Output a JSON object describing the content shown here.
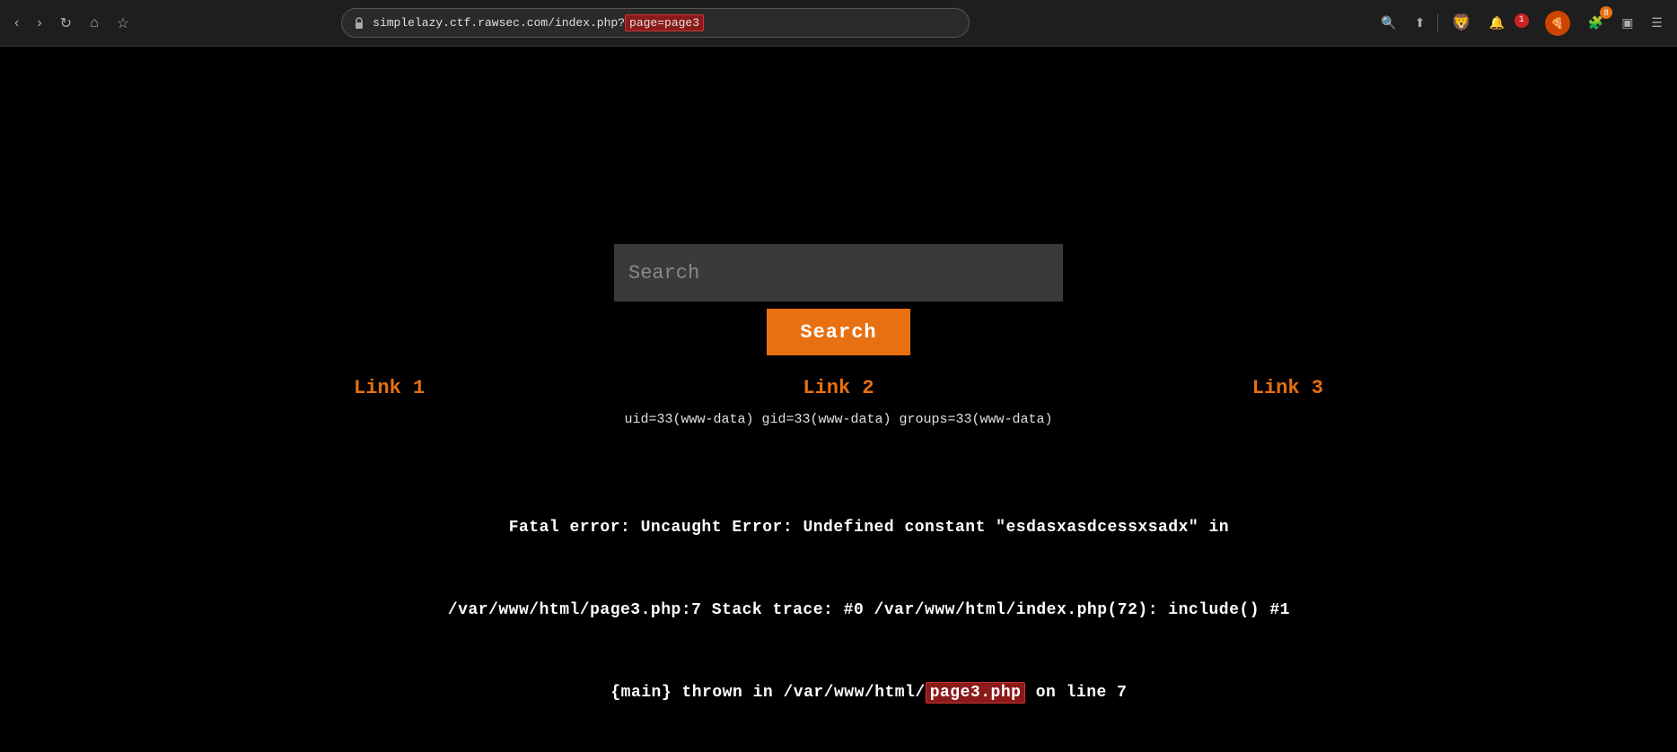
{
  "browser": {
    "url_prefix": "simplelazy.ctf.rawsec.com/index.php?",
    "url_param": "page=page3",
    "nav": {
      "back": "‹",
      "forward": "›",
      "reload": "↻",
      "home": "⌂"
    },
    "right_icons": {
      "zoom": "🔍",
      "share": "⬆",
      "brave": "🦁",
      "notification_count": "1"
    }
  },
  "page": {
    "search_placeholder": "Search",
    "search_button_label": "Search",
    "links": {
      "link1": "Link 1",
      "link2": "Link 2",
      "link3": "Link 3"
    },
    "uid_info": "uid=33(www-data) gid=33(www-data) groups=33(www-data)",
    "error": {
      "line1": "Fatal error: Uncaught Error: Undefined constant \"esdasxasdcessxsadx\" in",
      "line2": "/var/www/html/page3.php:7 Stack trace: #0 /var/www/html/index.php(72): include() #1",
      "line3_prefix": "{main} thrown in /var/www/html/",
      "line3_highlight": "page3.php",
      "line3_suffix": " on line 7"
    }
  }
}
